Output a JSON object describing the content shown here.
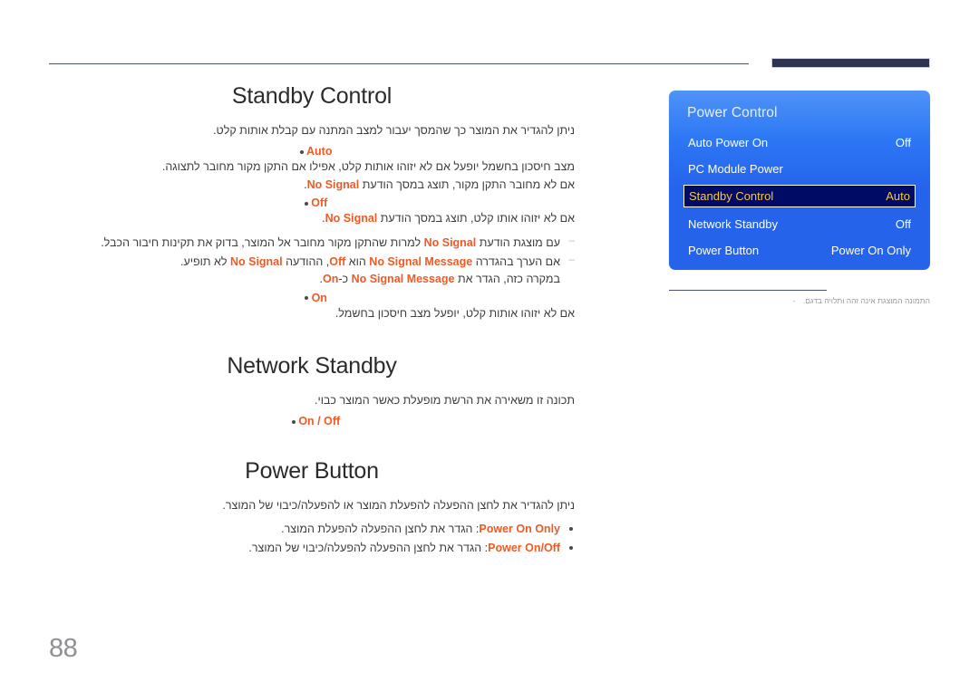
{
  "document": {
    "page_number": "88",
    "language": "he"
  },
  "sections": [
    {
      "id": "standby-control",
      "title": "Standby Control",
      "intro": "ניתן להגדיר את המוצר כך שהמסך יעבור למצב המתנה עם קבלת אותות קלט.",
      "bullets": [
        {
          "label": "Auto",
          "body_lines": [
            "מצב חיסכון בחשמל יופעל אם לא יזוהו אותות קלט, אפילו אם התקן מקור מחובר לתצוגה.",
            "אם לא מחובר התקן מקור, תוצג במסך הודעת No Signal."
          ],
          "body_html": [
            "מצב חיסכון בחשמל יופעל אם לא יזוהו אותות קלט, אפילו אם התקן מקור מחובר לתצוגה.",
            "אם לא מחובר התקן מקור, תוצג במסך הודעת <span class=\"bold-or\">No Signal</span>."
          ]
        },
        {
          "label": "Off",
          "body_lines": [
            "אם לא יזוהו אותו קלט, תוצג במסך הודעת No Signal."
          ],
          "body_html": [
            "אם לא יזוהו אותו קלט, תוצג במסך הודעת <span class=\"bold-or\">No Signal</span>."
          ],
          "notes": [
            "עם מוצגת הודעת <span class=\"bold-or\">No Signal</span> למרות שהתקן מקור מחובר אל המוצר, בדוק את תקינות חיבור הכבל.",
            "אם הערך בהגדרה <span class=\"bold-or\">No Signal Message</span> הוא <span class=\"bold-or\">Off</span>, ההודעה <span class=\"bold-or\">No Signal</span> לא תופיע.<br>במקרה כזה, הגדר את <span class=\"bold-or\">No Signal Message</span> כ-<span class=\"bold-or\">On</span>."
          ]
        },
        {
          "label": "On",
          "body_lines": [
            "אם לא יזוהו אותות קלט, יופעל מצב חיסכון בחשמל."
          ],
          "body_html": [
            "אם לא יזוהו אותות קלט, יופעל מצב חיסכון בחשמל."
          ]
        }
      ]
    },
    {
      "id": "network-standby",
      "title": "Network Standby",
      "intro": "תכונה זו משאירה את הרשת מופעלת כאשר המוצר כבוי.",
      "bullets": [
        {
          "label": "On / Off",
          "body_lines": [],
          "body_html": []
        }
      ]
    },
    {
      "id": "power-button",
      "title": "Power Button",
      "intro": "ניתן להגדיר את לחצן ההפעלה להפעלת המוצר או להפעלה/כיבוי של המוצר.",
      "inline_items": [
        "<span class=\"bold-or\">Power On Only</span>: הגדר את לחצן ההפעלה להפעלת המוצר.",
        "<span class=\"bold-or\">Power On/Off</span>: הגדר את לחצן ההפעלה להפעלה/כיבוי של המוצר."
      ]
    }
  ],
  "osd": {
    "title": "Power Control",
    "rows": [
      {
        "label": "Auto Power On",
        "value": "Off",
        "selected": false
      },
      {
        "label": "PC Module Power",
        "value": "",
        "selected": false
      },
      {
        "label": "Standby Control",
        "value": "Auto",
        "selected": true
      },
      {
        "label": "Network Standby",
        "value": "Off",
        "selected": false
      },
      {
        "label": "Power Button",
        "value": "Power On Only",
        "selected": false
      }
    ],
    "footnote_dash": "-",
    "footnote": "התמונה המוצגת אינה זהה ותלויה בדגם."
  },
  "colors": {
    "accent_orange": "#ef5a25",
    "osd_blue": "#2563eb",
    "osd_blue_light": "#4f93f7",
    "osd_selected_bg": "#000b66",
    "osd_selected_text": "#f5c842",
    "rule_navy": "#2e3352",
    "page_number_gray": "#8f8f94"
  }
}
